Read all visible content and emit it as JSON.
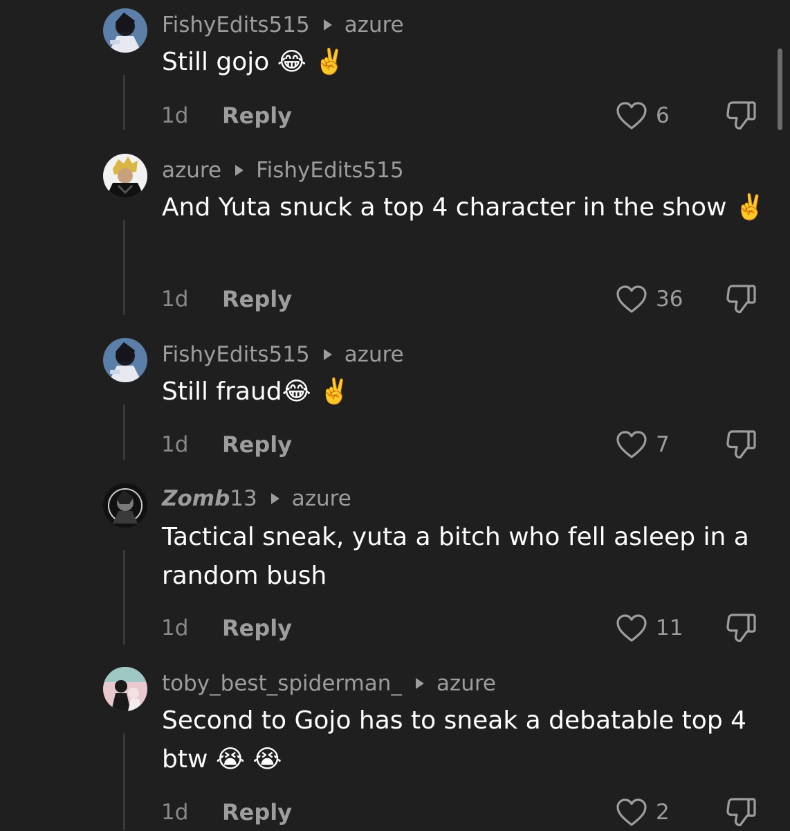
{
  "thread": {
    "comments": [
      {
        "author": "FishyEdits515",
        "reply_to": "azure",
        "text": "Still gojo 😂 ✌️",
        "time": "1d",
        "reply_label": "Reply",
        "likes": "6",
        "author_italic": false
      },
      {
        "author": "azure",
        "reply_to": "FishyEdits515",
        "text": "And Yuta snuck a top 4 character in the show ✌️",
        "time": "1d",
        "reply_label": "Reply",
        "likes": "36",
        "author_italic": false
      },
      {
        "author": "FishyEdits515",
        "reply_to": "azure",
        "text": "Still fraud😂 ✌️",
        "time": "1d",
        "reply_label": "Reply",
        "likes": "7",
        "author_italic": false
      },
      {
        "author_styled": "Zomb",
        "author_plain": "13",
        "reply_to": "azure",
        "text": "Tactical sneak, yuta a bitch who fell asleep in a random bush",
        "time": "1d",
        "reply_label": "Reply",
        "likes": "11",
        "author_italic": true
      },
      {
        "author": "toby_best_spiderman_",
        "reply_to": "azure",
        "text": "Second to Gojo has to sneak a debatable top 4 btw 😭 😭",
        "time": "1d",
        "reply_label": "Reply",
        "likes": "2",
        "author_italic": false
      }
    ]
  },
  "icons": {
    "like": "heart-outline-icon",
    "dislike": "thumbs-down-outline-icon",
    "reply_arrow": "triangle-right-icon"
  },
  "colors": {
    "background": "#1f1f1f",
    "text_primary": "#ffffff",
    "text_secondary": "#9d9d9d"
  }
}
